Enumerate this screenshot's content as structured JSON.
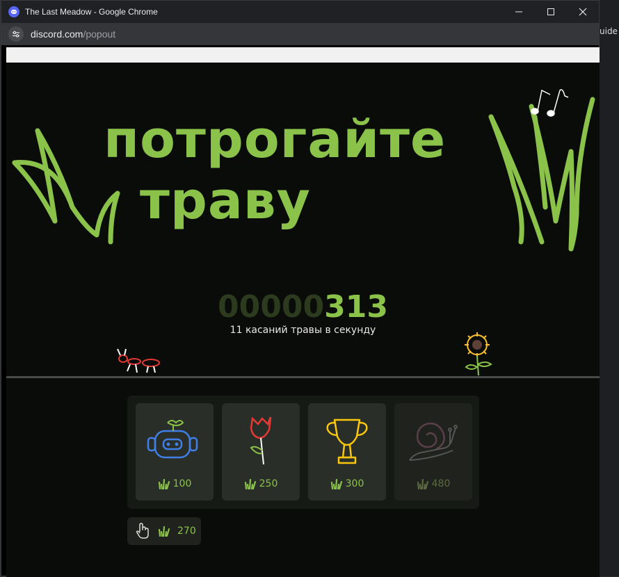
{
  "window": {
    "title": "The Last Meadow - Google Chrome",
    "url_host": "discord.com",
    "url_path": "/popout"
  },
  "background_page": {
    "right_snippet": "uide ::"
  },
  "game": {
    "title_line1": "потрогайте",
    "title_line2": "траву",
    "counter_leading_zeros": "00000",
    "counter_value": "313",
    "rate_count": "11",
    "rate_text": "касаний травы в секунду"
  },
  "shop": {
    "items": [
      {
        "name": "robot",
        "price": "100",
        "locked": false
      },
      {
        "name": "flower",
        "price": "250",
        "locked": false
      },
      {
        "name": "trophy",
        "price": "300",
        "locked": false
      },
      {
        "name": "snail",
        "price": "480",
        "locked": true
      }
    ]
  },
  "clicker": {
    "value": "270"
  },
  "colors": {
    "accent": "#8bc34a",
    "background": "#0a0c09"
  }
}
